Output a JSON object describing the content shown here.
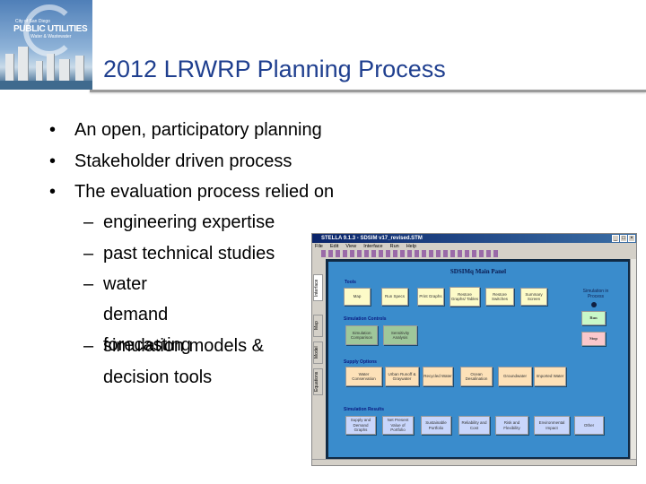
{
  "logo": {
    "line1": "City of San Diego",
    "line2": "PUBLIC UTILITIES",
    "line3": "Water & Wastewater"
  },
  "slide": {
    "title": "2012 LRWRP Planning Process",
    "bullets": [
      "An open, participatory planning",
      "Stakeholder driven process",
      "The evaluation process relied on"
    ],
    "subbullets": [
      "engineering expertise",
      "past technical studies",
      "water demand forecasting",
      "simulation models & decision tools"
    ]
  },
  "screenshot": {
    "window_title": "STELLA 9.1.3 - SDSIM v17_revised.STM",
    "window_controls": [
      "_",
      "□",
      "×"
    ],
    "menu": [
      "File",
      "Edit",
      "View",
      "Interface",
      "Run",
      "Help"
    ],
    "side_tabs": [
      "Interface",
      "Map",
      "Model",
      "Equations"
    ],
    "panel_title": "SDSIMq Main Panel",
    "status": "Simulation in Process",
    "tools": {
      "label": "Tools",
      "buttons": [
        "Map",
        "Run Specs",
        "Print Graphs",
        "Restore Graphs/ Tables",
        "Restore Switches",
        "Summary Screen"
      ]
    },
    "controls": {
      "label": "Simulation Controls",
      "buttons": [
        "Simulation Comparison",
        "Sensitivity Analysis"
      ]
    },
    "run": "Run",
    "stop": "Stop",
    "supply": {
      "label": "Supply Options",
      "buttons": [
        "Water Conservation",
        "Urban Runoff & Graywater",
        "Recycled Water",
        "Ocean Desalination",
        "Groundwater",
        "Imported Water"
      ]
    },
    "results": {
      "label": "Simulation Results",
      "buttons": [
        "Supply and Demand Graphs",
        "Net Present Value of Portfolio",
        "Sustainable Portfolio",
        "Reliability and Cost",
        "Risk and Flexibility",
        "Environmental Impact",
        "Other"
      ]
    }
  }
}
